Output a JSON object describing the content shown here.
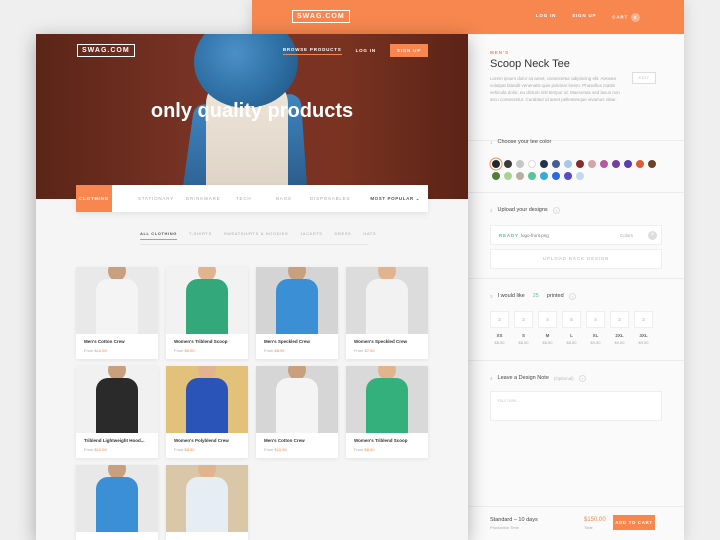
{
  "brand": "SWAG.COM",
  "back_nav": [
    "LOG IN",
    "SIGN UP",
    "CART"
  ],
  "cart_count": "0",
  "product": {
    "category": "MEN'S",
    "title": "Scoop Neck Tee",
    "description": "Lorem ipsum dolor sit amet, consectetur adipiscing elit. Aenean volutpat blandit venenatis quis pulvinar lorem. Phasellus mattis vehicula dolor, eu dictum nisl tempor id. Maecenas sed lacus non arcu consectetur. Curabitur id amet pellentesque vivamus vitae.",
    "edit_label": "EDIT"
  },
  "color_section": {
    "num": "1",
    "title": "Choose your tee color",
    "swatches": [
      "#1e2a2a",
      "#3b3b3b",
      "#c7c7c7",
      "#ffffff",
      "#243146",
      "#445f92",
      "#a8c8ea",
      "#8a2b2b",
      "#d7a4a8",
      "#b6589b",
      "#7a3e9d",
      "#5a3bb5",
      "#e05a36",
      "#6a4326",
      "#4e7d3a",
      "#a5d68f",
      "#b7b0a0",
      "#56c39a",
      "#3aa9d6",
      "#2a6ae3",
      "#5a4ac7",
      "#c4d7f2"
    ]
  },
  "upload_section": {
    "num": "2",
    "title": "Upload your designs",
    "status": "READY",
    "file": "logo-front.png",
    "file_color": "Colors",
    "button": "UPLOAD BACK DESIGN"
  },
  "qty_section": {
    "num": "3",
    "title_pre": "I would like",
    "qty": "25",
    "title_post": "printed",
    "sizes": [
      {
        "qty": "3",
        "label": "XS",
        "price": "$8.50"
      },
      {
        "qty": "3",
        "label": "S",
        "price": "$8.50"
      },
      {
        "qty": "4",
        "label": "M",
        "price": "$8.50"
      },
      {
        "qty": "5",
        "label": "L",
        "price": "$8.50"
      },
      {
        "qty": "4",
        "label": "XL",
        "price": "$9.50"
      },
      {
        "qty": "3",
        "label": "2XL",
        "price": "$9.50"
      },
      {
        "qty": "3",
        "label": "3XL",
        "price": "$9.50"
      }
    ]
  },
  "note_section": {
    "num": "4",
    "title": "Leave a Design Note",
    "optional": "(Optional)",
    "placeholder": "Your note..."
  },
  "footer": {
    "production": "Standard – 10 days",
    "production_sub": "Production Time",
    "price": "$150.00",
    "price_sub": "Total",
    "add_to_cart": "ADD TO CART"
  },
  "front_nav": {
    "browse": "BROWSE PRODUCTS",
    "login": "LOG IN",
    "signup": "SIGN UP"
  },
  "hero_title": "only quality products",
  "categories": [
    "CLOTHING",
    "STATIONARY",
    "DRINKWARE",
    "TECH",
    "BAGS",
    "DISPOSABLES"
  ],
  "sort": "MOST POPULAR",
  "sub_tabs": [
    "ALL CLOTHING",
    "T-SHIRTS",
    "SWEATSHIRTS & HOODIES",
    "JACKETS",
    "DRESS",
    "HATS"
  ],
  "products": [
    {
      "name": "Men's Cotton Crew",
      "from": "From",
      "price": "$10.50",
      "color": "#f4f4f4",
      "skin": "#c9a07e",
      "bg": "#e9e9e9"
    },
    {
      "name": "Women's Triblend Scoop",
      "from": "From",
      "price": "$8.00",
      "color": "#33a87a",
      "skin": "#e2b48e",
      "bg": "#f2f2f2"
    },
    {
      "name": "Men's Speckled Crew",
      "from": "From",
      "price": "$8.95",
      "color": "#3b8fd4",
      "skin": "#c9a07e",
      "bg": "#d4d4d4"
    },
    {
      "name": "Women's Speckled Crew",
      "from": "From",
      "price": "$7.95",
      "color": "#f2f2f2",
      "skin": "#e2b48e",
      "bg": "#dcdcdc"
    },
    {
      "name": "Triblend Lightweight Hood...",
      "from": "From",
      "price": "$10.50",
      "color": "#2a2a2a",
      "skin": "#c9a07e",
      "bg": "#f1f1f1"
    },
    {
      "name": "Women's Polyblend Crew",
      "from": "From",
      "price": "$8.50",
      "color": "#2a54b8",
      "skin": "#e2b48e",
      "bg": "#e2c17a"
    },
    {
      "name": "Men's Cotton Crew",
      "from": "From",
      "price": "$10.50",
      "color": "#f4f4f4",
      "skin": "#c9a07e",
      "bg": "#d6d6d6"
    },
    {
      "name": "Women's Triblend Scoop",
      "from": "From",
      "price": "$8.00",
      "color": "#33b07c",
      "skin": "#e2b48e",
      "bg": "#d9d9d9"
    },
    {
      "name": "",
      "from": "",
      "price": "",
      "color": "#3b8fd4",
      "skin": "#c9a07e",
      "bg": "#e8e8e8"
    },
    {
      "name": "",
      "from": "",
      "price": "",
      "color": "#e6eef4",
      "skin": "#e2b48e",
      "bg": "#d9c7a8"
    }
  ]
}
